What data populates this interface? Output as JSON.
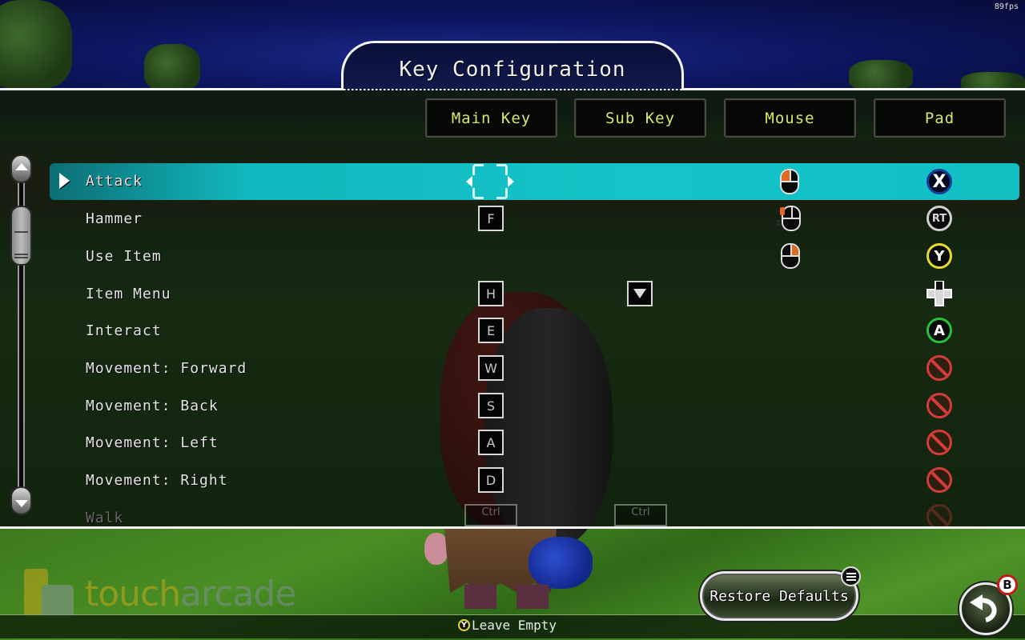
{
  "hud": {
    "fps": "89fps"
  },
  "title": "Key Configuration",
  "columns": [
    "Main Key",
    "Sub Key",
    "Mouse",
    "Pad"
  ],
  "scrollbar": {
    "position_fraction": 0.0
  },
  "rows": [
    {
      "label": "Attack",
      "selected": true,
      "main_key": "",
      "sub_key": "",
      "mouse": "mouse-left-button",
      "pad": "X"
    },
    {
      "label": "Hammer",
      "main_key": "F",
      "sub_key": "",
      "mouse": "mouse-left-double-click",
      "pad": "RT"
    },
    {
      "label": "Use Item",
      "main_key": "",
      "sub_key": "",
      "mouse": "mouse-right-button",
      "pad": "Y"
    },
    {
      "label": "Item Menu",
      "main_key": "H",
      "sub_key": "▼",
      "mouse": "",
      "pad": "D-Pad Down"
    },
    {
      "label": "Interact",
      "main_key": "E",
      "sub_key": "",
      "mouse": "",
      "pad": "A"
    },
    {
      "label": "Movement: Forward",
      "main_key": "W",
      "sub_key": "",
      "mouse": "",
      "pad": "none"
    },
    {
      "label": "Movement: Back",
      "main_key": "S",
      "sub_key": "",
      "mouse": "",
      "pad": "none"
    },
    {
      "label": "Movement: Left",
      "main_key": "A",
      "sub_key": "",
      "mouse": "",
      "pad": "none"
    },
    {
      "label": "Movement: Right",
      "main_key": "D",
      "sub_key": "",
      "mouse": "",
      "pad": "none"
    },
    {
      "label": "Walk",
      "faded": true,
      "main_key": "Ctrl",
      "sub_key": "Ctrl",
      "mouse": "",
      "pad": "none"
    }
  ],
  "mouse_double_click_count": "2",
  "footer": {
    "hint_button": "Y",
    "hint_label": "Leave Empty",
    "restore_defaults": "Restore Defaults",
    "back_badge": "B"
  },
  "watermark": {
    "part1": "touch",
    "part2": "arcade"
  }
}
